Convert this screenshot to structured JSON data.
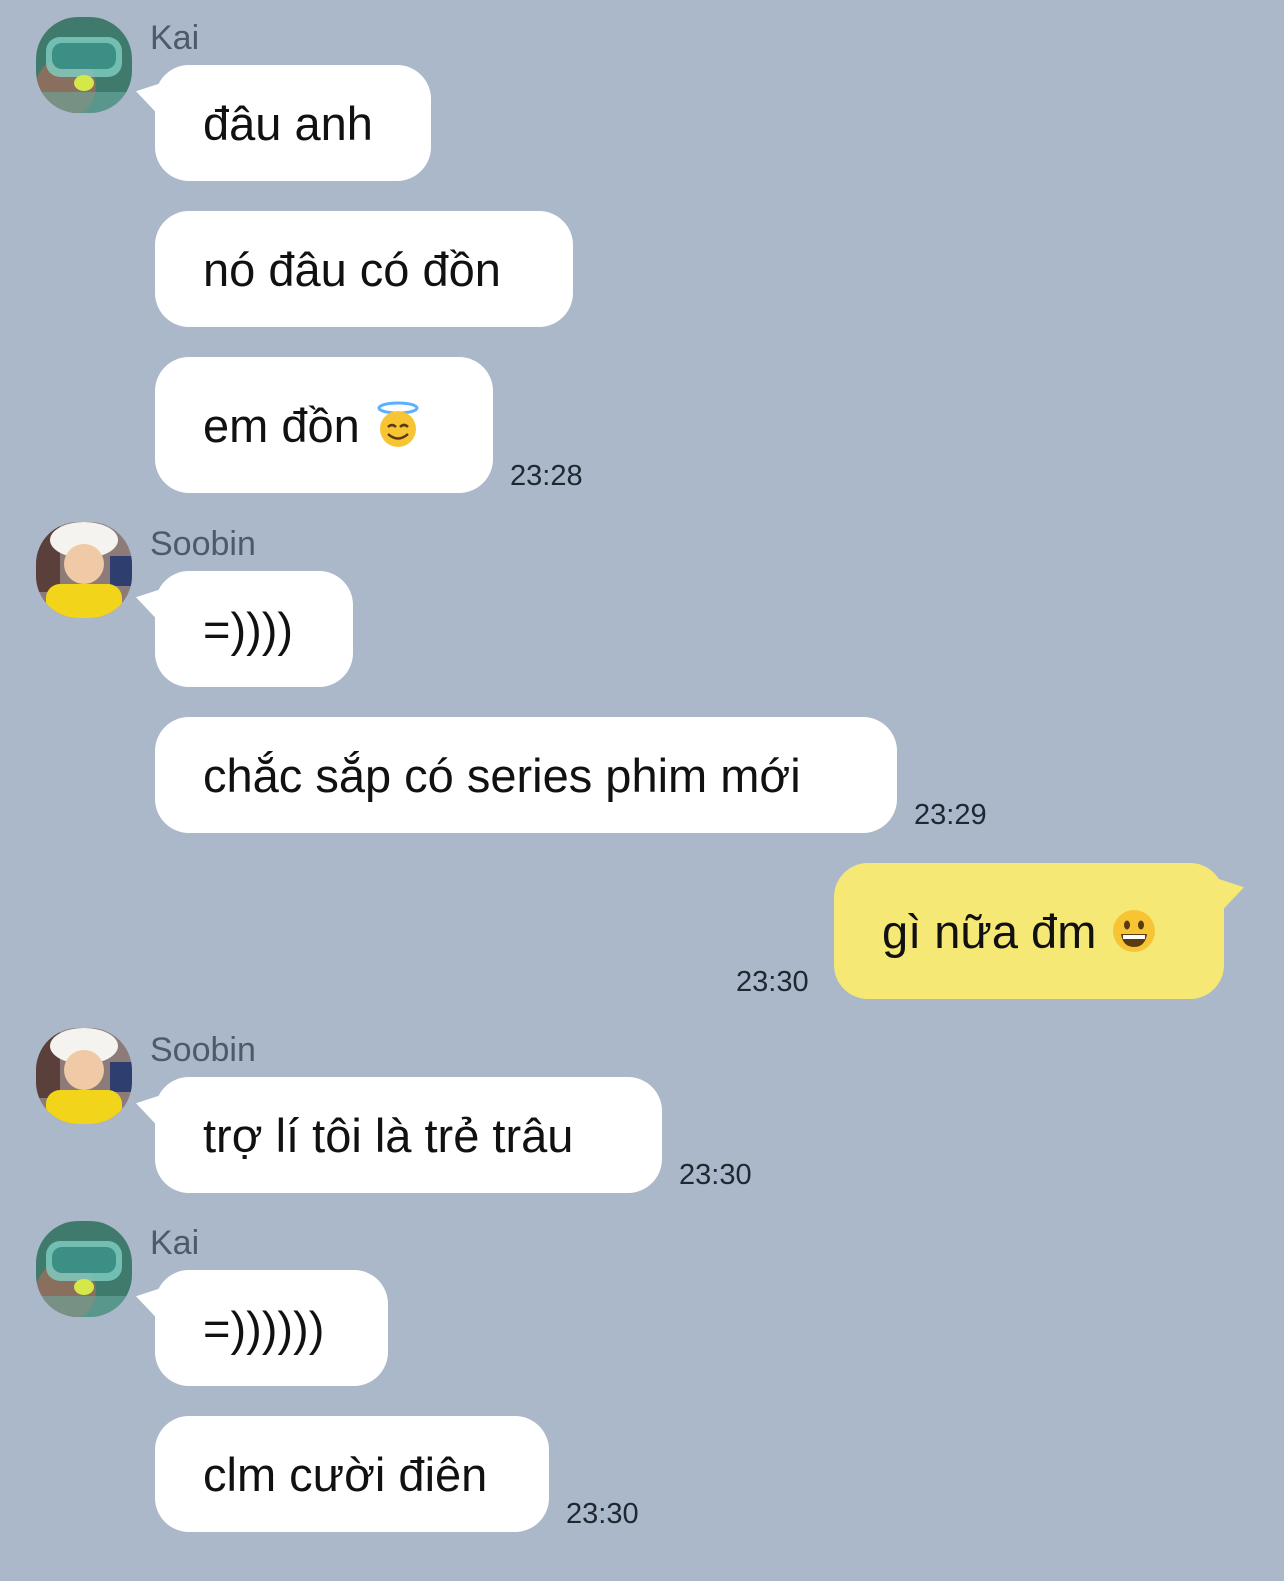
{
  "colors": {
    "background": "#abb8c9",
    "incoming_bubble": "#ffffff",
    "outgoing_bubble": "#f6e875",
    "sender_name": "#4e5a6a",
    "timestamp": "#1f2733"
  },
  "groups": [
    {
      "sender": "Kai",
      "avatar": "avatar-kai",
      "messages": [
        {
          "text": "đâu anh"
        },
        {
          "text": "nó đâu có đồn"
        },
        {
          "text": "em đồn",
          "emoji": "smiling-face-with-halo-icon"
        }
      ],
      "time": "23:28"
    },
    {
      "sender": "Soobin",
      "avatar": "avatar-soobin",
      "messages": [
        {
          "text": "=))))"
        },
        {
          "text": "chắc sắp có series phim mới"
        }
      ],
      "time": "23:29"
    },
    {
      "sender": "",
      "outgoing": true,
      "messages": [
        {
          "text": "gì nữa đm",
          "emoji": "grinning-face-icon"
        }
      ],
      "time": "23:30"
    },
    {
      "sender": "Soobin",
      "avatar": "avatar-soobin",
      "messages": [
        {
          "text": "trợ lí tôi là trẻ trâu"
        }
      ],
      "time": "23:30"
    },
    {
      "sender": "Kai",
      "avatar": "avatar-kai",
      "messages": [
        {
          "text": "=))))))"
        },
        {
          "text": "clm cười điên"
        }
      ],
      "time": "23:30"
    }
  ]
}
